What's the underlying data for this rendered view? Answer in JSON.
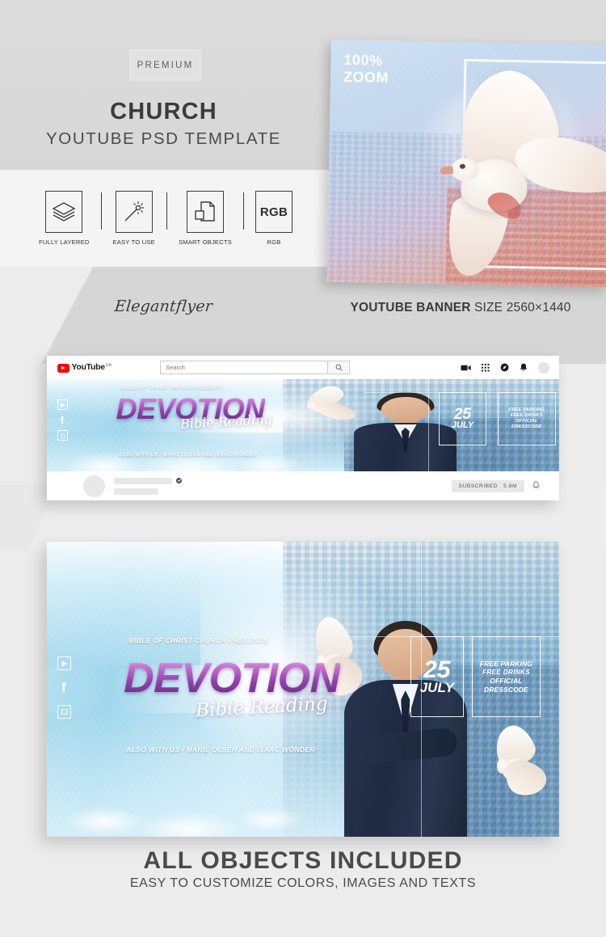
{
  "promo": {
    "badge": "PREMIUM",
    "title": "CHURCH",
    "subtitle": "YOUTUBE PSD TEMPLATE",
    "brand": "Elegantflyer",
    "banner_size_bold": "YOUTUBE BANNER",
    "banner_size_light": "SIZE 2560×1440"
  },
  "features": [
    {
      "icon": "layers-icon",
      "label": "FULLY LAYERED"
    },
    {
      "icon": "magic-wand-icon",
      "label": "EASY TO USE"
    },
    {
      "icon": "smart-object-icon",
      "label": "SMART OBJECTS"
    },
    {
      "icon": "rgb-icon",
      "label": "RGB",
      "badge": "RGB"
    }
  ],
  "zoom_preview": {
    "line1": "100%",
    "line2": "ZOOM"
  },
  "youtube_mock": {
    "logo_word": "YouTube",
    "logo_country": "UA",
    "search_placeholder": "Search",
    "search_value": "",
    "icons": [
      "video-camera-icon",
      "apps-grid-icon",
      "compass-icon",
      "bell-icon",
      "avatar-icon"
    ],
    "channel": {
      "subscribed_label": "SUBSCRIBED",
      "subscriber_count": "5.8M",
      "bell_icon": "notification-bell-icon"
    }
  },
  "banner": {
    "presents": "BIBLE OF CHRIST CHURCH PRESENTS",
    "headline": "DEVOTION",
    "script": "Bible Reading",
    "credits": "ALSO WITH US / MARIE OLSEN AND ISAAC WONDER",
    "date_day": "25",
    "date_month": "JULY",
    "info_lines": [
      "FREE PARKING",
      "FREE DRINKS",
      "OFFICIAL",
      "DRESSCODE"
    ],
    "social": [
      "youtube-icon",
      "facebook-icon",
      "instagram-icon"
    ]
  },
  "footer": {
    "headline": "ALL OBJECTS INCLUDED",
    "subline": "EASY TO CUSTOMIZE COLORS, IMAGES AND TEXTS"
  },
  "colors": {
    "accent_red": "#ff0000",
    "headline_purple": "#8e3fa8",
    "page_bg": "#d8d8d8",
    "panel_bg": "#f4f4f4"
  }
}
